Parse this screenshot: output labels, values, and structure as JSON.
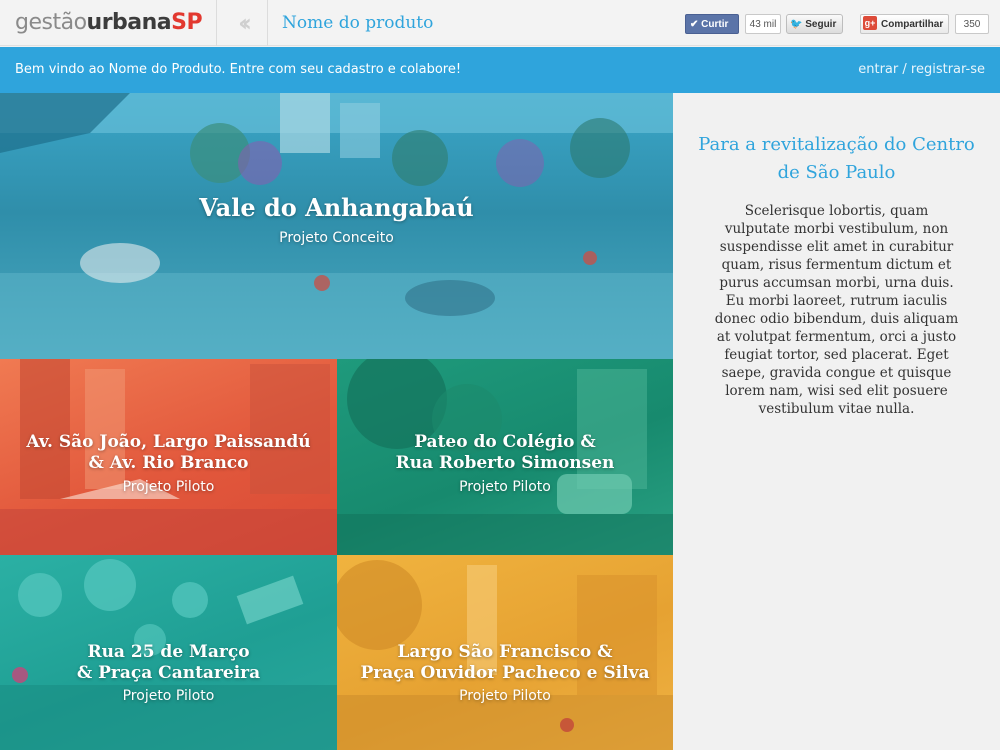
{
  "header": {
    "logo": {
      "part1": "gestão",
      "part2": "urbana",
      "part3": "SP"
    },
    "back_icon": "double-chevron-left-icon",
    "product_name": "Nome do produto",
    "social": {
      "like_label": "Curtir",
      "like_count": "43 mil",
      "tweet_label": "Seguir",
      "share_label": "Compartilhar",
      "share_count": "350"
    }
  },
  "bar": {
    "welcome": "Bem vindo ao Nome do Produto. Entre com seu cadastro e colabore!",
    "login": "entrar",
    "divider": "/",
    "register": "registrar-se"
  },
  "tiles": [
    {
      "title": "Vale do Anhangabaú",
      "subtitle": "Projeto Conceito",
      "color": "#2f9abd"
    },
    {
      "title_line1": "Av. São João, Largo Paissandú",
      "title_line2": "& Av. Rio Branco",
      "subtitle": "Projeto Piloto",
      "color": "#e45a3c"
    },
    {
      "title_line1": "Pateo do Colégio &",
      "title_line2": "Rua Roberto Simonsen",
      "subtitle": "Projeto Piloto",
      "color": "#1a9174"
    },
    {
      "title_line1": "Rua 25 de Março",
      "title_line2": "& Praça Cantareira",
      "subtitle": "Projeto Piloto",
      "color": "#23a69a"
    },
    {
      "title_line1": "Largo São Francisco &",
      "title_line2": "Praça Ouvidor Pacheco e Silva",
      "subtitle": "Projeto Piloto",
      "color": "#eaa838"
    }
  ],
  "side": {
    "heading": "Para a revitalização do Centro de São Paulo",
    "body": "Scelerisque lobortis, quam vulputate morbi vestibulum, non suspendisse elit amet in curabitur quam, risus fermentum dictum et purus accumsan morbi, urna duis. Eu morbi laoreet, rutrum iaculis donec odio bibendum, duis aliquam at volutpat fermentum, orci a justo feugiat tortor, sed placerat. Eget saepe, gravida congue et quisque lorem nam, wisi sed elit posuere vestibulum vitae nulla."
  },
  "colors": {
    "accent": "#2fa4dc",
    "logo_red": "#e2382f"
  }
}
